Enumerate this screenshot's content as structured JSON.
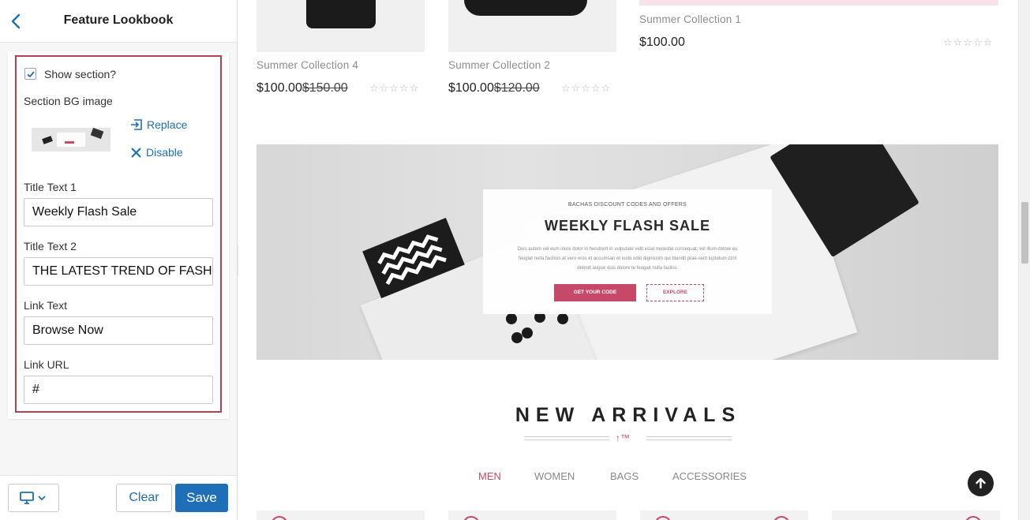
{
  "panel": {
    "title": "Feature Lookbook",
    "show_section": {
      "label": "Show section?",
      "checked": true
    },
    "bg_image": {
      "label": "Section BG image",
      "replace_label": "Replace",
      "disable_label": "Disable"
    },
    "fields": [
      {
        "label": "Title Text 1",
        "value": "Weekly Flash Sale"
      },
      {
        "label": "Title Text 2",
        "value": "THE LATEST TREND OF FASHION"
      },
      {
        "label": "Link Text",
        "value": "Browse Now"
      },
      {
        "label": "Link URL",
        "value": "#"
      }
    ],
    "footer": {
      "clear_label": "Clear",
      "save_label": "Save",
      "device_icon": "desktop-icon"
    }
  },
  "preview": {
    "products": [
      {
        "name": "Summer Collection 4",
        "price": "$100.00",
        "old_price": "$150.00"
      },
      {
        "name": "Summer Collection 2",
        "price": "$100.00",
        "old_price": "$120.00"
      },
      {
        "name": "Summer Collection 1",
        "price": "$100.00"
      }
    ],
    "stars": "☆☆☆☆☆",
    "banner": {
      "small_text": "BACHAS DISCOUNT CODES AND OFFERS",
      "title": "WEEKLY FLASH SALE",
      "body": "Duis autem vel eum iriure dolor in hendrerit in vulputate velit esse molestie consequat, vel illum dolore eu feugiat nulla facilisis at vero eros et accumsan et iusto odio dignissim qui blandit prae-sent luptatum zzril delenit augue duis dolore te feugait nulla facilisi.",
      "btn_primary": "GET YOUR CODE",
      "btn_secondary": "EXPLORE"
    },
    "arrivals": {
      "title": "NEW ARRIVALS",
      "mark": "↑™",
      "tabs": [
        "MEN",
        "WOMEN",
        "BAGS",
        "ACCESSORIES"
      ],
      "active_tab": "MEN"
    }
  },
  "colors": {
    "accent": "#1e6fb8",
    "brand": "#c7496a",
    "outline": "#b5434f"
  }
}
